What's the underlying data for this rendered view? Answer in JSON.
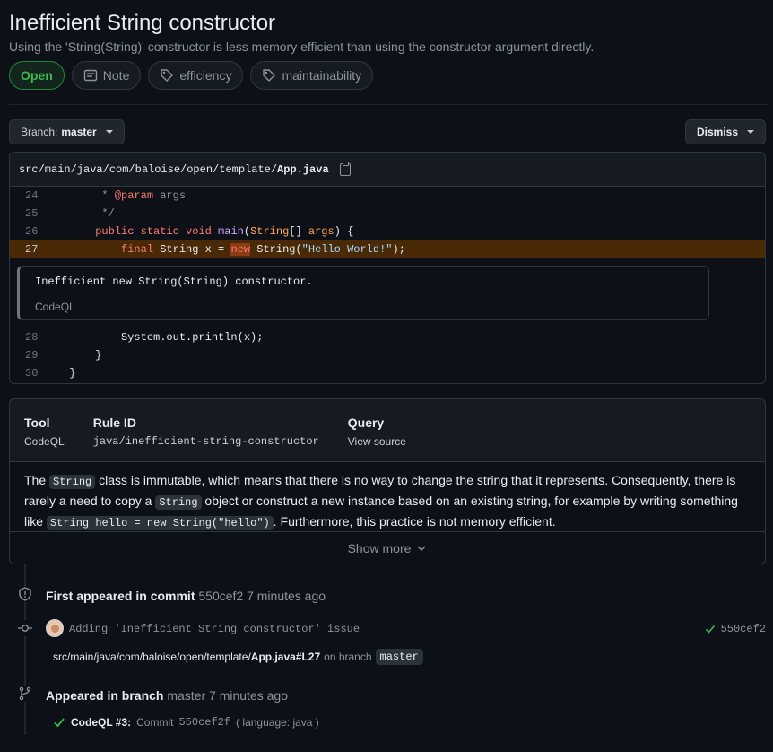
{
  "header": {
    "title": "Inefficient String constructor",
    "subtitle": "Using the 'String(String)' constructor is less memory efficient than using the constructor argument directly.",
    "labels": {
      "status": "Open",
      "severity": "Note",
      "tag1": "efficiency",
      "tag2": "maintainability"
    }
  },
  "toolbar": {
    "branch_prefix": "Branch:",
    "branch_name": "master",
    "dismiss_label": "Dismiss"
  },
  "file": {
    "path_prefix": "src/main/java/com/baloise/open/template/",
    "path_file": "App.java"
  },
  "code": {
    "l24_num": "24",
    "l24_a": "       * ",
    "l24_ann": "@param",
    "l24_b": " args",
    "l25_num": "25",
    "l25": "       */",
    "l26_num": "26",
    "l27_num": "27",
    "l28_num": "28",
    "l28": "          System.out.println(x);",
    "l29_num": "29",
    "l29": "      }",
    "l30_num": "30",
    "l30": "  }"
  },
  "alert": {
    "message": "Inefficient new String(String) constructor.",
    "source": "CodeQL"
  },
  "rule": {
    "tool_label": "Tool",
    "tool_value": "CodeQL",
    "rule_id_label": "Rule ID",
    "rule_id_value": "java/inefficient-string-constructor",
    "query_label": "Query",
    "query_value": "View source",
    "desc_1": "The ",
    "desc_code1": "String",
    "desc_2": " class is immutable, which means that there is no way to change the string that it represents. Consequently, there is rarely a need to copy a ",
    "desc_code2": "String",
    "desc_3": " object or construct a new instance based on an existing string, for example by writing something like ",
    "desc_code3": "String hello = new String(\"hello\")",
    "desc_4": ". Furthermore, this practice is not memory efficient.",
    "show_more": "Show more"
  },
  "timeline": {
    "first_appeared_label": "First appeared in commit",
    "first_appeared_meta": "550cef2 7 minutes ago",
    "commit_message": "Adding 'Inefficient String constructor' issue",
    "commit_sha": "550cef2",
    "location_path_prefix": "src/main/java/com/baloise/open/template/",
    "location_path_file": "App.java#L27",
    "on_branch": "on branch",
    "branch": "master",
    "appeared_branch_label": "Appeared in branch",
    "appeared_branch_meta": "master 7 minutes ago",
    "check_name": "CodeQL #3:",
    "check_detail_prefix": "Commit",
    "check_detail_sha": "550cef2f",
    "check_detail_suffix": "( language: java )"
  },
  "colors": {
    "accent_green": "#3fb950",
    "highlight_line": "#4a2a06",
    "background": "#0d1117"
  }
}
